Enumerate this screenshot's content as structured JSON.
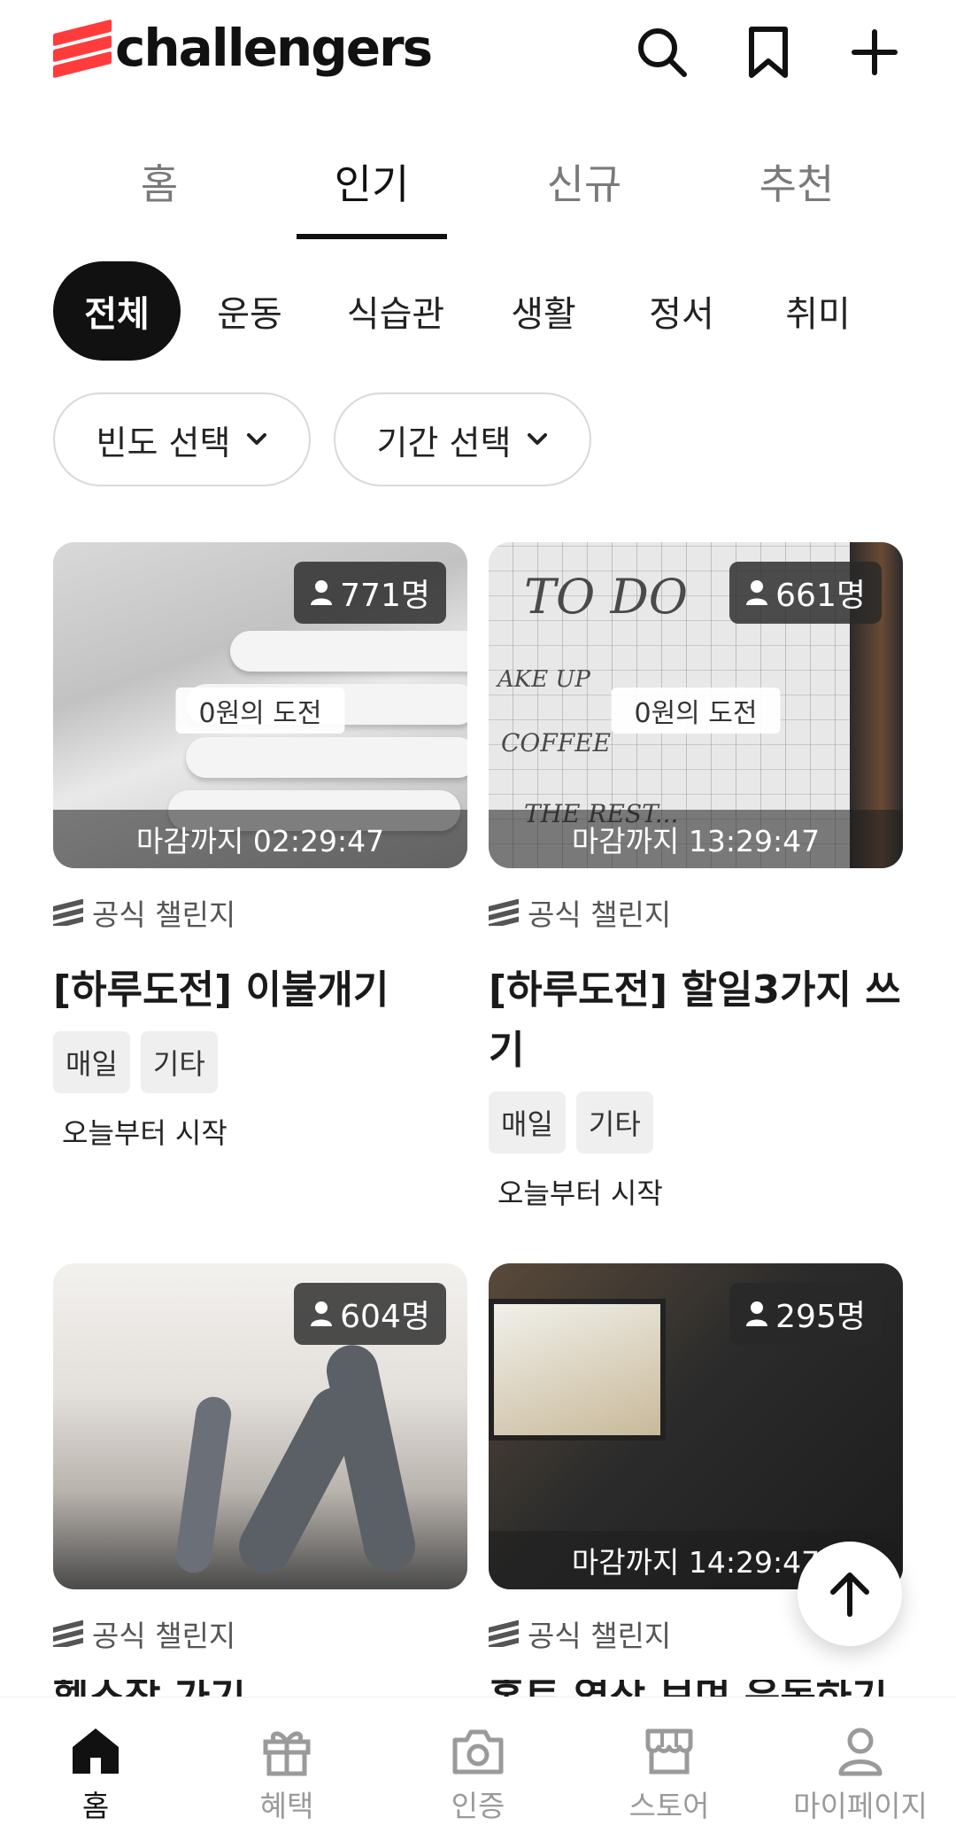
{
  "app": {
    "logo_text": "challengers",
    "brand_color": "#ff3b3b"
  },
  "header": {
    "icons": [
      "search-icon",
      "bookmark-icon",
      "plus-icon"
    ]
  },
  "top_tabs": [
    {
      "label": "홈",
      "active": false
    },
    {
      "label": "인기",
      "active": true
    },
    {
      "label": "신규",
      "active": false
    },
    {
      "label": "추천",
      "active": false
    }
  ],
  "categories": [
    {
      "label": "전체",
      "active": true
    },
    {
      "label": "운동",
      "active": false
    },
    {
      "label": "식습관",
      "active": false
    },
    {
      "label": "생활",
      "active": false
    },
    {
      "label": "정서",
      "active": false
    },
    {
      "label": "취미",
      "active": false
    }
  ],
  "filters": [
    {
      "label": "빈도 선택"
    },
    {
      "label": "기간 선택"
    }
  ],
  "cards": [
    {
      "count": "771명",
      "free_label": "0원의 도전",
      "deadline": "마감까지 02:29:47",
      "official": "공식 챌린지",
      "title": "[하루도전] 이불개기",
      "tags": [
        "매일",
        "기타"
      ],
      "start": "오늘부터 시작"
    },
    {
      "count": "661명",
      "free_label": "0원의 도전",
      "deadline": "마감까지 13:29:47",
      "official": "공식 챌린지",
      "title": "[하루도전] 할일3가지 쓰기",
      "tags": [
        "매일",
        "기타"
      ],
      "start": "오늘부터 시작",
      "note_lines": [
        "TO DO",
        "AKE UP",
        "COFFEE",
        "THE REST..."
      ]
    },
    {
      "count": "604명",
      "official": "공식 챌린지",
      "title_partial": "헬스장 가기"
    },
    {
      "count": "295명",
      "deadline": "마감까지 14:29:47",
      "official": "공식 챌린지",
      "title_partial": "홈트 영상 보며 운동하기"
    }
  ],
  "bottom_nav": [
    {
      "label": "홈",
      "icon": "home-icon",
      "active": true
    },
    {
      "label": "혜택",
      "icon": "gift-icon",
      "active": false
    },
    {
      "label": "인증",
      "icon": "camera-icon",
      "active": false
    },
    {
      "label": "스토어",
      "icon": "store-icon",
      "active": false
    },
    {
      "label": "마이페이지",
      "icon": "person-icon",
      "active": false
    }
  ]
}
